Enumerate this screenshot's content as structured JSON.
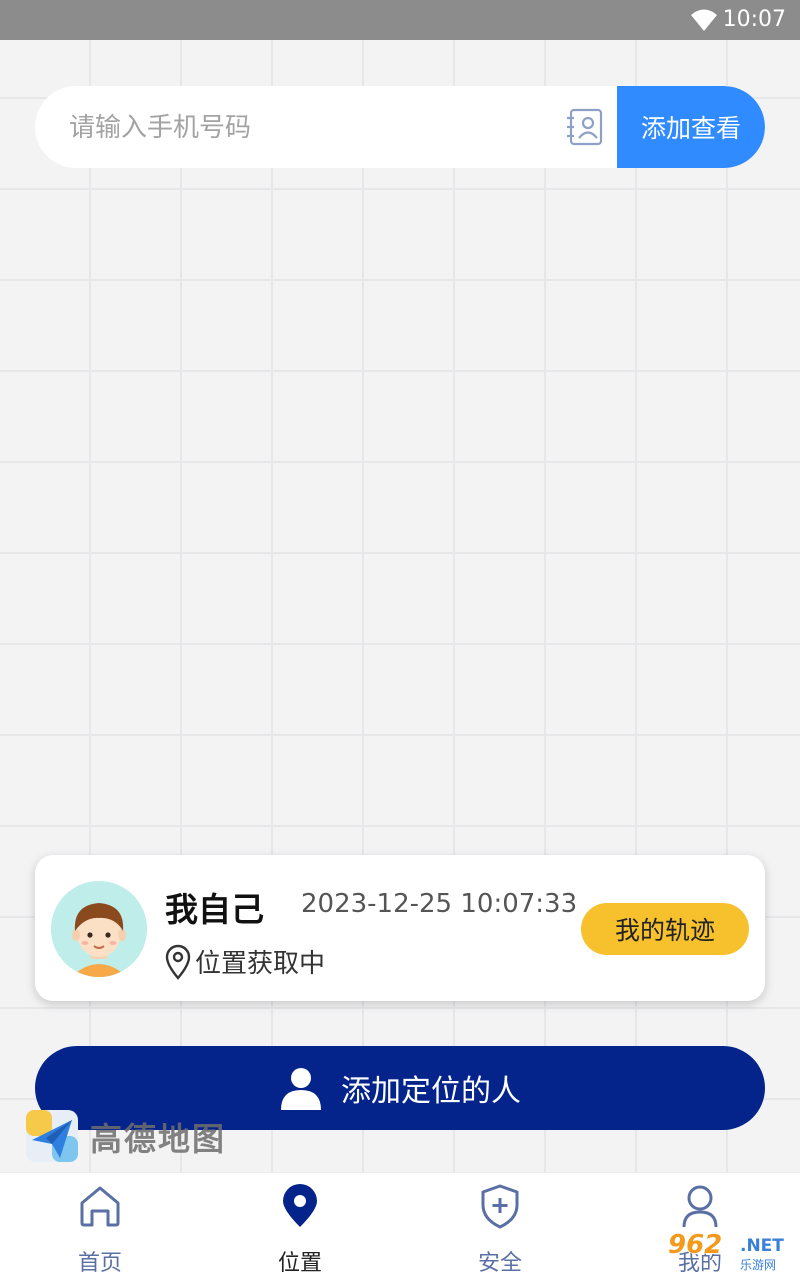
{
  "status_bar": {
    "time": "10:07",
    "wifi_icon": "wifi-icon"
  },
  "search": {
    "placeholder": "请输入手机号码",
    "value": "",
    "contact_icon": "contact-book-icon",
    "button_label": "添加查看"
  },
  "self_card": {
    "name": "我自己",
    "timestamp": "2023-12-25 10:07:33",
    "location_status": "位置获取中",
    "track_button": "我的轨迹"
  },
  "add_person_button": "添加定位的人",
  "map_logo": {
    "wordmark": "高德地图"
  },
  "bottom_nav": {
    "items": [
      {
        "label": "首页",
        "icon": "home-icon",
        "active": false
      },
      {
        "label": "位置",
        "icon": "location-pin-icon",
        "active": true
      },
      {
        "label": "安全",
        "icon": "shield-plus-icon",
        "active": false
      },
      {
        "label": "我的",
        "icon": "user-icon",
        "active": false
      }
    ]
  },
  "watermark": {
    "brand": "962",
    "suffix": ".NET",
    "sub": "乐游网"
  },
  "colors": {
    "accent_blue": "#2f8bff",
    "navy_button": "#04248b",
    "track_yellow": "#f7c12e",
    "nav_icon": "#5a6fa3"
  }
}
